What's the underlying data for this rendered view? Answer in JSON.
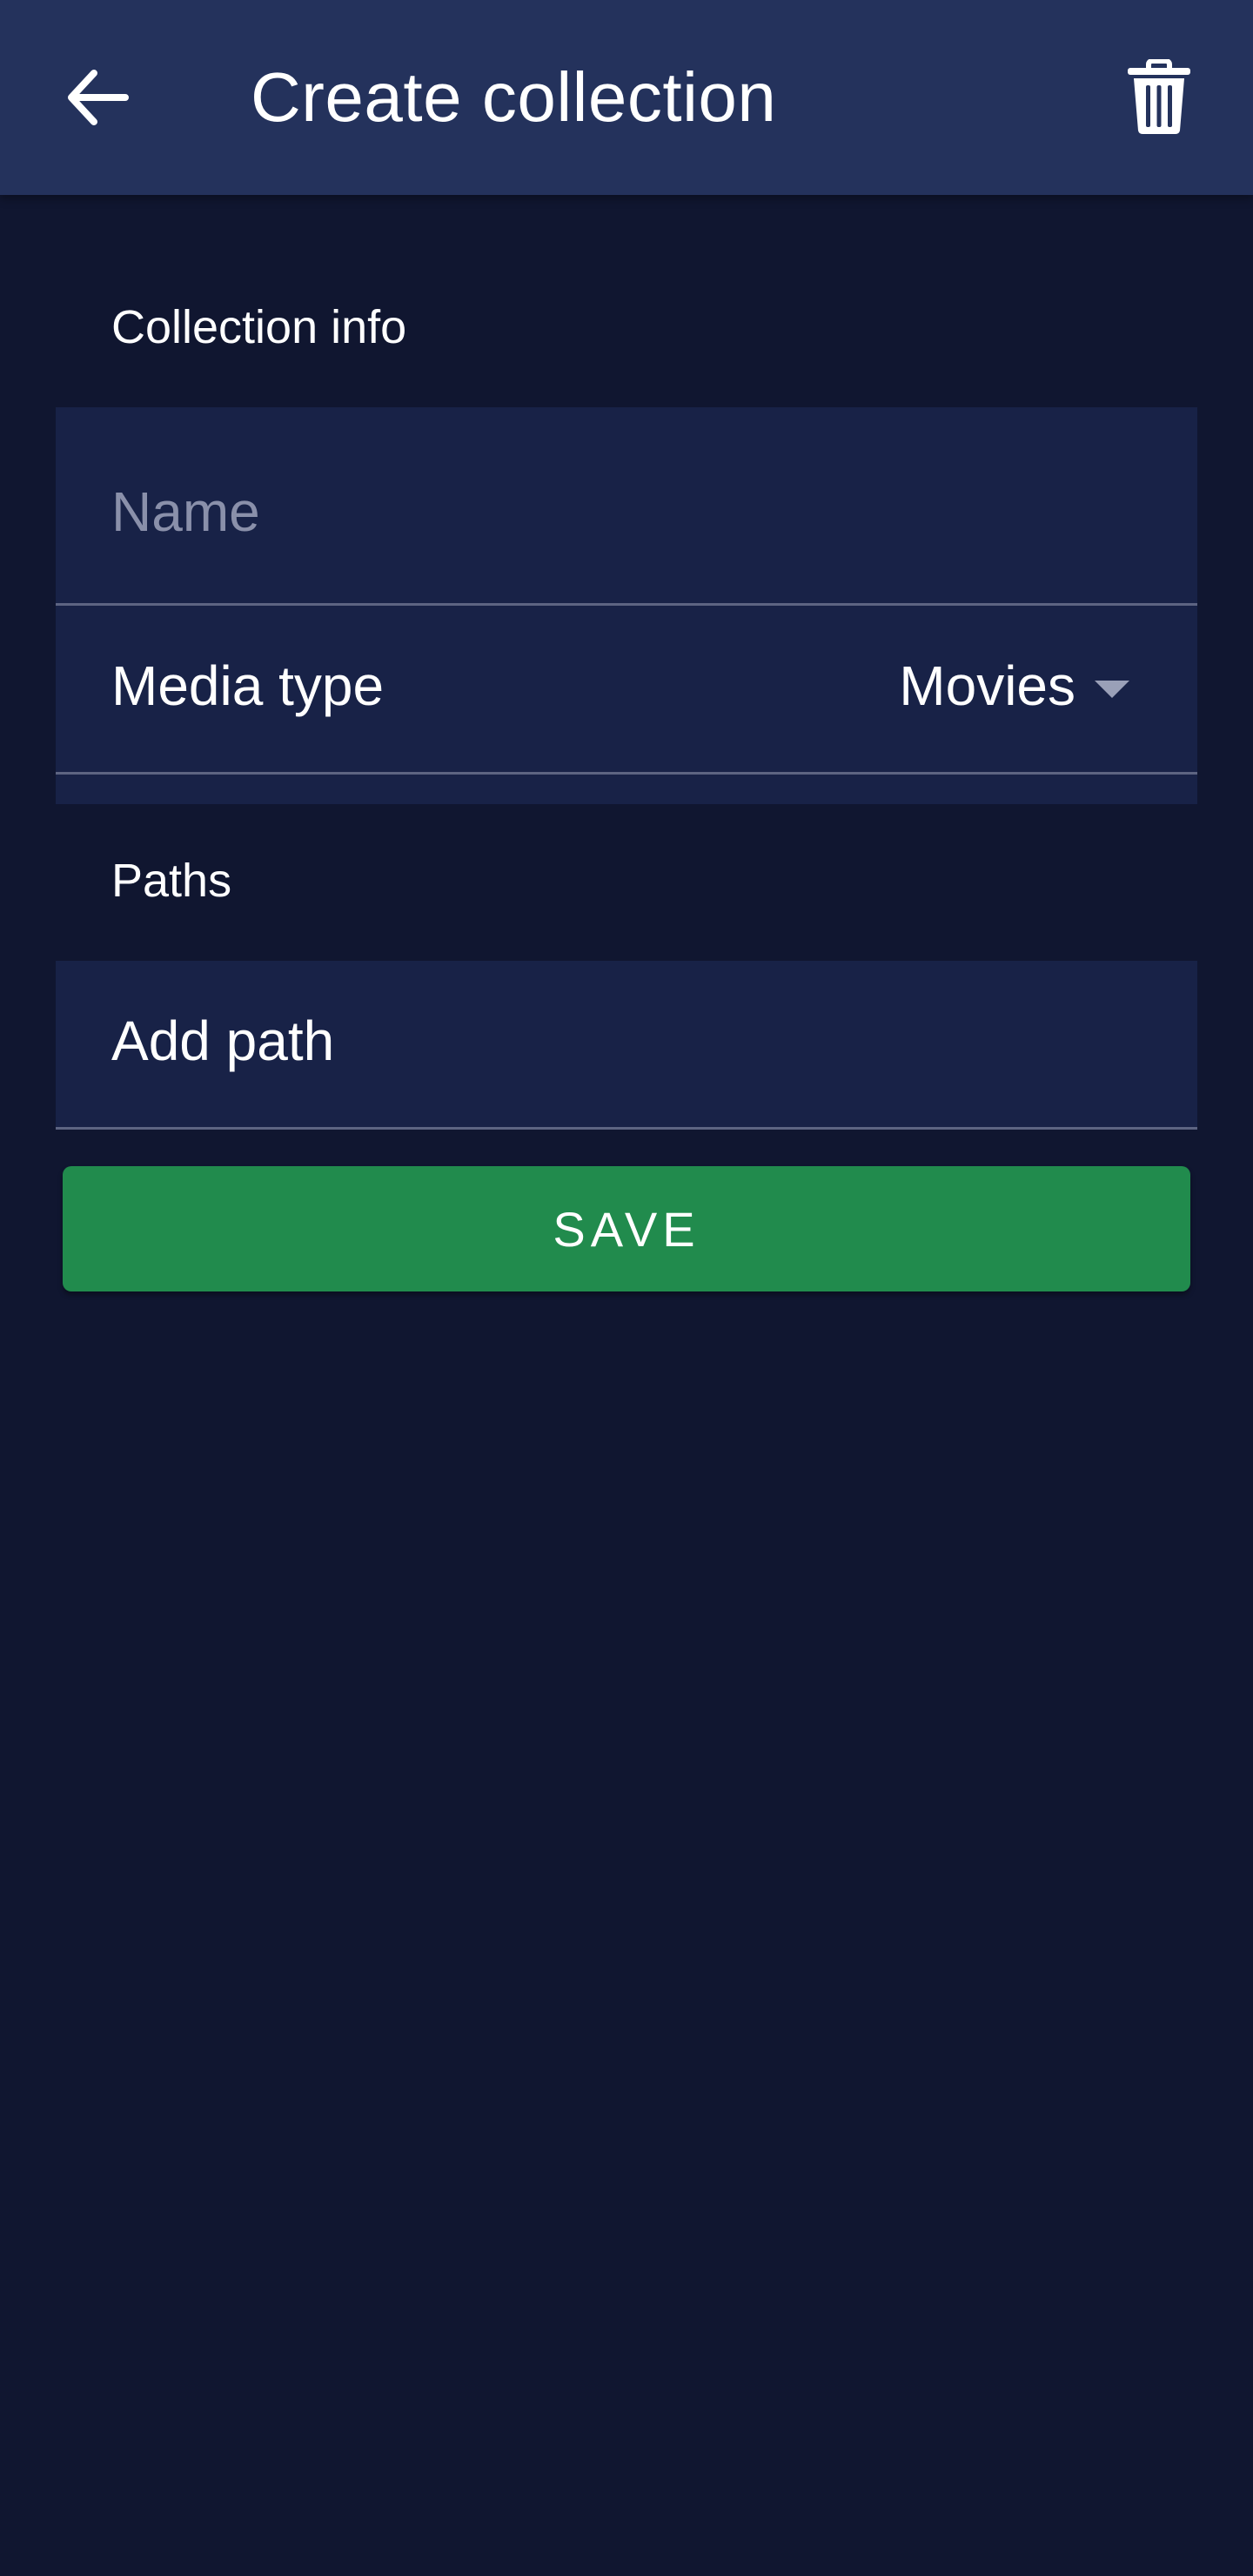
{
  "header": {
    "title": "Create collection",
    "back_icon": "arrow-left-icon",
    "delete_icon": "trash-icon"
  },
  "sections": {
    "collection_info": {
      "title": "Collection info",
      "name_field": {
        "value": "",
        "placeholder": "Name"
      },
      "media_type": {
        "label": "Media type",
        "selected": "Movies"
      }
    },
    "paths": {
      "title": "Paths",
      "add_path_label": "Add path"
    }
  },
  "actions": {
    "save_label": "SAVE"
  },
  "colors": {
    "appbar": "#24325c",
    "background": "#101630",
    "card": "#182247",
    "save_button": "#218b4d",
    "divider": "#5d6482"
  }
}
